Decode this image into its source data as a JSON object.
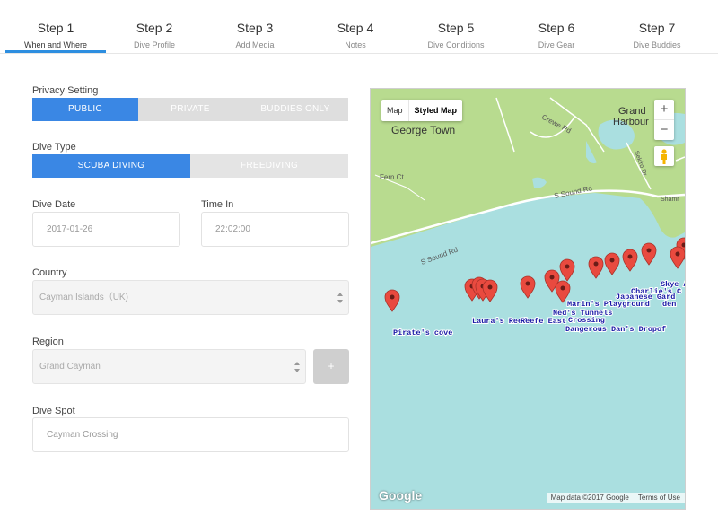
{
  "steps": [
    {
      "title": "Step 1",
      "subtitle": "When and Where",
      "active": true
    },
    {
      "title": "Step 2",
      "subtitle": "Dive Profile"
    },
    {
      "title": "Step 3",
      "subtitle": "Add Media"
    },
    {
      "title": "Step 4",
      "subtitle": "Notes"
    },
    {
      "title": "Step 5",
      "subtitle": "Dive Conditions"
    },
    {
      "title": "Step 6",
      "subtitle": "Dive Gear"
    },
    {
      "title": "Step 7",
      "subtitle": "Dive Buddies"
    }
  ],
  "privacy": {
    "label": "Privacy Setting",
    "options": [
      "PUBLIC",
      "PRIVATE",
      "BUDDIES ONLY"
    ],
    "selected": "PUBLIC"
  },
  "dive_type": {
    "label": "Dive Type",
    "options": [
      "SCUBA DIVING",
      "FREEDIVING"
    ],
    "selected": "SCUBA DIVING"
  },
  "dive_date": {
    "label": "Dive Date",
    "value": "2017-01-26"
  },
  "time_in": {
    "label": "Time In",
    "value": "22:02:00"
  },
  "country": {
    "label": "Country",
    "value": "Cayman Islands（UK)"
  },
  "region": {
    "label": "Region",
    "value": "Grand Cayman",
    "add_label": "+"
  },
  "dive_spot": {
    "label": "Dive Spot",
    "value": "Cayman Crossing"
  },
  "map": {
    "type_options": [
      "Map",
      "Styled Map"
    ],
    "zoom_in": "+",
    "zoom_out": "−",
    "place_labels": {
      "george_town": "George Town",
      "grand_harbour_1": "Grand",
      "grand_harbour_2": "Harbour",
      "crewe_rd": "Crewe Rd",
      "fern_ct": "Fern Ct",
      "s_sound_rd_1": "S Sound Rd",
      "s_sound_rd_2": "S Sound Rd",
      "sekiro_dr": "Sekiro Dr",
      "shamrock": "Shamr"
    },
    "dive_labels": {
      "pirates_cove": "Pirate's cove",
      "lauras_reef": "Laura's Reef",
      "reefe_east": "Reefe East",
      "neds_tunnels": "Ned's Tunnels",
      "crossing": "Crossing",
      "marins_playground": "Marin's Playground",
      "japanese_gardens": "Japanese Gard",
      "charlies": "Charlie's C",
      "skye": "Skye A",
      "dangerous_dans": "Dangerous Dan's Dropof",
      "den": "den"
    },
    "attribution": "Map data ©2017 Google",
    "terms": "Terms of Use",
    "logo": "Google",
    "colors": {
      "water": "#aadfe0",
      "land": "#b8db8f",
      "road": "#ffffff",
      "marker": "#e94a3f",
      "label": "#1a1aa6"
    }
  }
}
